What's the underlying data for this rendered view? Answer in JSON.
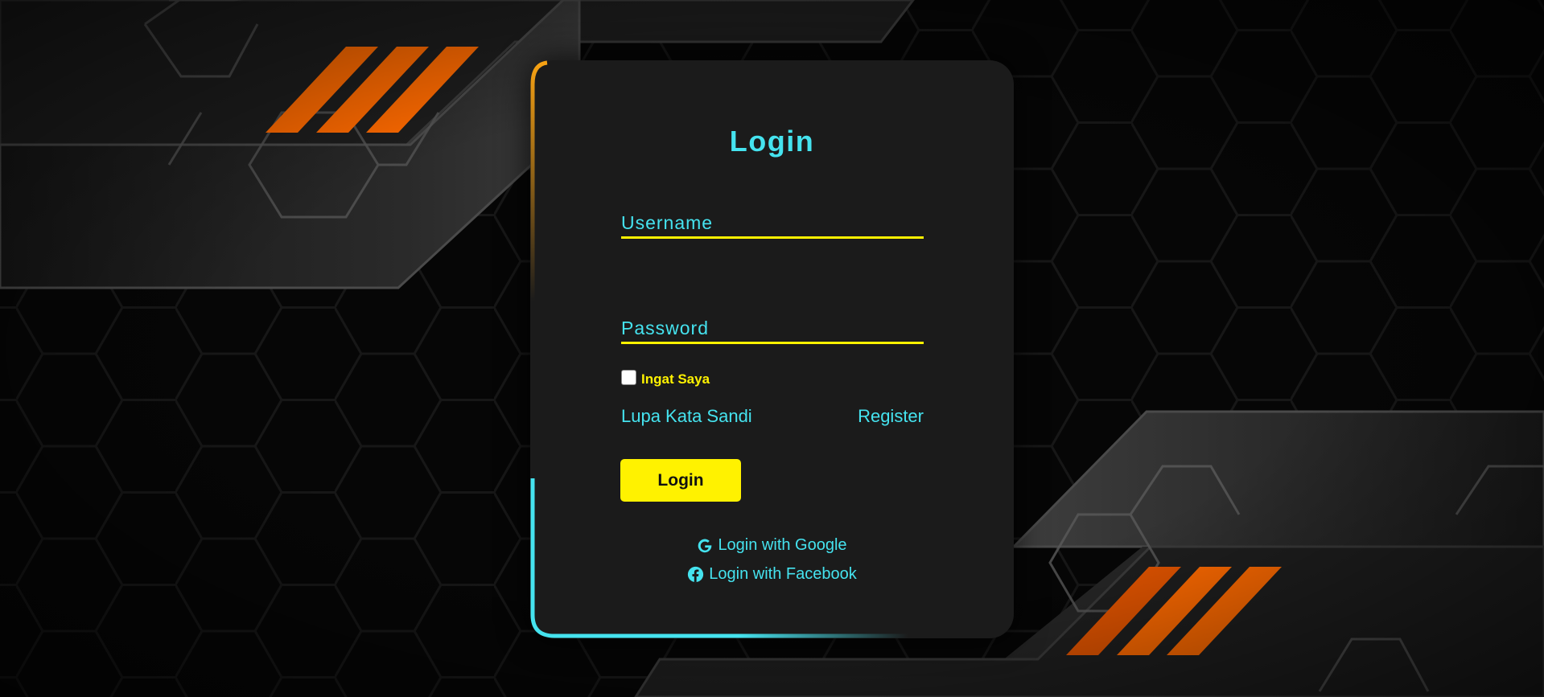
{
  "login_form": {
    "title": "Login",
    "username_placeholder": "Username",
    "password_placeholder": "Password",
    "remember_label": "Ingat Saya",
    "remember_checked": false,
    "forgot_password_label": "Lupa Kata Sandi",
    "register_label": "Register",
    "submit_label": "Login",
    "google_label": "Login with Google",
    "facebook_label": "Login with Facebook"
  },
  "icons": {
    "google": "google-g-icon",
    "facebook": "facebook-icon"
  },
  "colors": {
    "accent_cyan": "#45e3ef",
    "accent_yellow": "#fff200",
    "accent_orange": "#f7a213",
    "stripe_orange": "#ff6a00",
    "card_background": "#1b1b1b",
    "page_background": "#050505"
  }
}
